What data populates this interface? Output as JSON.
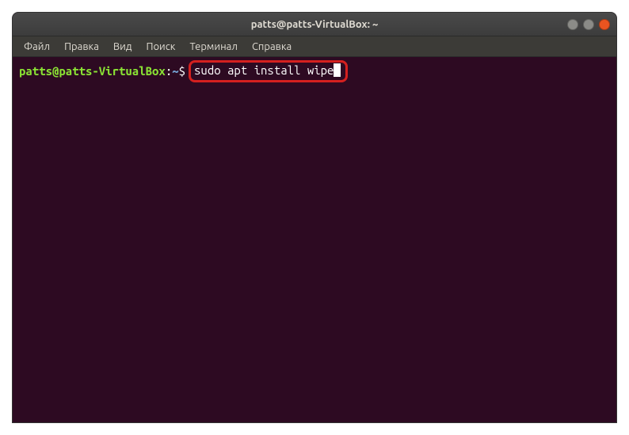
{
  "window": {
    "title": "patts@patts-VirtualBox: ~"
  },
  "menubar": {
    "items": [
      {
        "label": "Файл"
      },
      {
        "label": "Правка"
      },
      {
        "label": "Вид"
      },
      {
        "label": "Поиск"
      },
      {
        "label": "Терминал"
      },
      {
        "label": "Справка"
      }
    ]
  },
  "terminal": {
    "prompt": {
      "user_host": "patts@patts-VirtualBox",
      "separator": ":",
      "path": "~",
      "symbol": "$"
    },
    "command": "sudo apt install wipe"
  }
}
